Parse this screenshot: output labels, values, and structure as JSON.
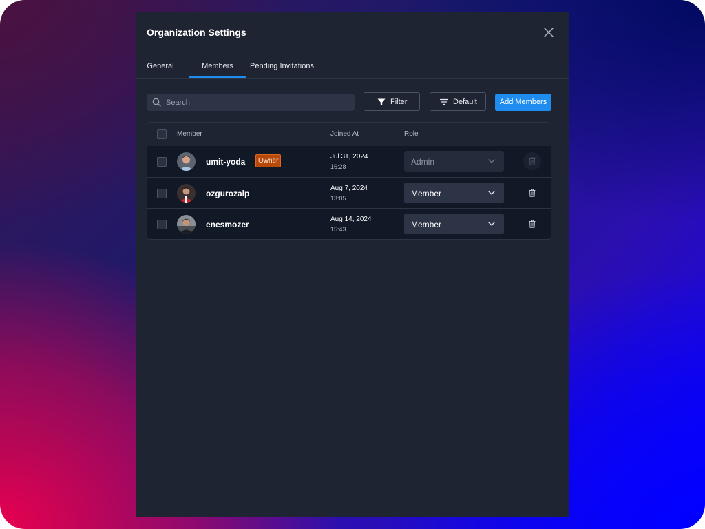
{
  "modal": {
    "title": "Organization Settings"
  },
  "tabs": [
    {
      "label": "General",
      "active": false
    },
    {
      "label": "Members",
      "active": true
    },
    {
      "label": "Pending Invitations",
      "active": false
    }
  ],
  "toolbar": {
    "search_placeholder": "Search",
    "search_value": "",
    "filter_label": "Filter",
    "sort_label": "Default",
    "add_label": "Add Members"
  },
  "table": {
    "headers": {
      "member": "Member",
      "joined_at": "Joined At",
      "role": "Role"
    },
    "rows": [
      {
        "username": "umit-yoda",
        "badge": "Owner",
        "date": "Jul 31, 2024",
        "time": "16:28",
        "role": "Admin",
        "role_disabled": true,
        "delete_disabled": true
      },
      {
        "username": "ozgurozalp",
        "badge": "",
        "date": "Aug 7, 2024",
        "time": "13:05",
        "role": "Member",
        "role_disabled": false,
        "delete_disabled": false
      },
      {
        "username": "enesmozer",
        "badge": "",
        "date": "Aug 14, 2024",
        "time": "15:43",
        "role": "Member",
        "role_disabled": false,
        "delete_disabled": false
      }
    ]
  },
  "colors": {
    "modal_bg": "#1e2432",
    "accent": "#1f8cf0",
    "owner_badge": "#b7490b",
    "row_bg": "#111826"
  },
  "icons": {
    "close": "close-icon",
    "search": "search-icon",
    "filter": "filter-icon",
    "sort": "sort-lines-icon",
    "chevron": "chevron-down-icon",
    "trash": "trash-icon"
  }
}
